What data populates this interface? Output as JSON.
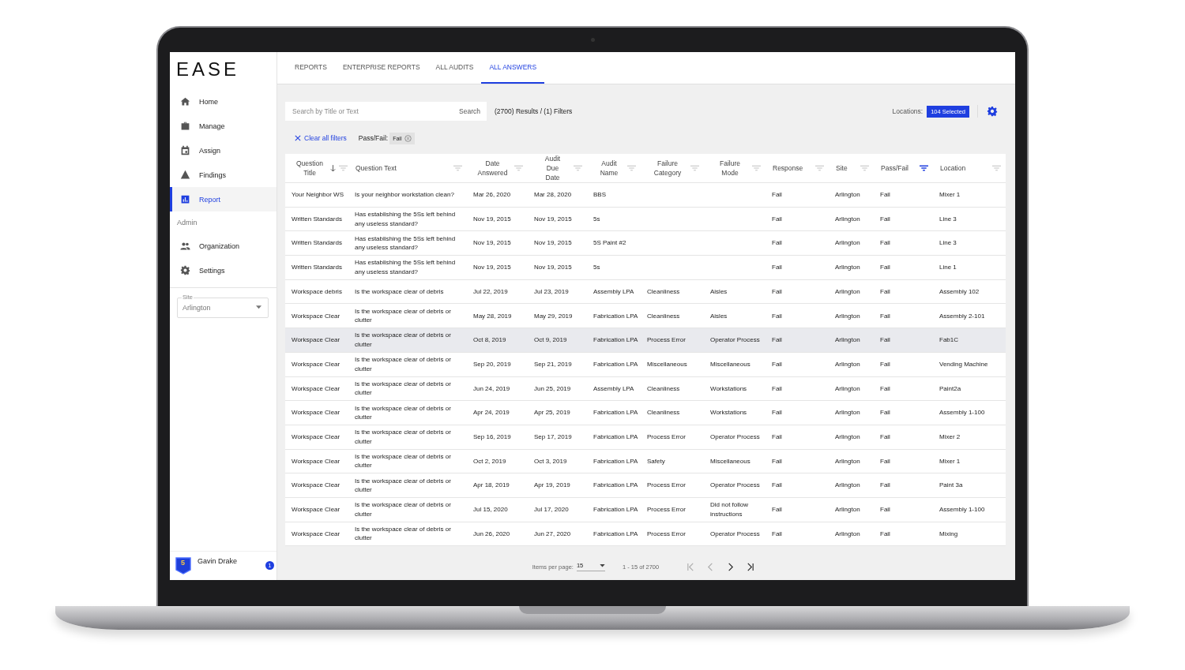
{
  "logo": "EASE",
  "sidebar": {
    "items": [
      {
        "label": "Home",
        "selected": false
      },
      {
        "label": "Manage",
        "selected": false
      },
      {
        "label": "Assign",
        "selected": false
      },
      {
        "label": "Findings",
        "selected": false
      },
      {
        "label": "Report",
        "selected": true
      }
    ],
    "section_label": "Admin",
    "admin_items": [
      {
        "label": "Organization",
        "selected": false
      },
      {
        "label": "Settings",
        "selected": false
      }
    ],
    "site_select": {
      "label": "Site",
      "value": "Arlington"
    },
    "user": {
      "name": "Gavin Drake",
      "level": "5",
      "notifications": "1"
    }
  },
  "tabs": [
    {
      "label": "REPORTS",
      "selected": false
    },
    {
      "label": "ENTERPRISE REPORTS",
      "selected": false
    },
    {
      "label": "ALL AUDITS",
      "selected": false
    },
    {
      "label": "ALL ANSWERS",
      "selected": true
    }
  ],
  "search": {
    "placeholder": "Search by Title or Text",
    "button": "Search"
  },
  "results_summary": "(2700) Results / (1) Filters",
  "locations": {
    "label": "Locations:",
    "value": "104 Selected"
  },
  "filters": {
    "clear_label": "Clear all filters",
    "chips": [
      {
        "label": "Pass/Fail:",
        "value": "Fail"
      }
    ]
  },
  "table": {
    "columns": [
      {
        "label": "Question Title",
        "sorted_desc": true,
        "filter_active": false
      },
      {
        "label": "Question Text",
        "sorted_desc": false,
        "filter_active": false
      },
      {
        "label": "Date Answered",
        "sorted_desc": false,
        "filter_active": false
      },
      {
        "label": "Audit Due Date",
        "sorted_desc": false,
        "filter_active": false
      },
      {
        "label": "Audit Name",
        "sorted_desc": false,
        "filter_active": false
      },
      {
        "label": "Failure Category",
        "sorted_desc": false,
        "filter_active": false
      },
      {
        "label": "Failure Mode",
        "sorted_desc": false,
        "filter_active": false
      },
      {
        "label": "Response",
        "sorted_desc": false,
        "filter_active": false
      },
      {
        "label": "Site",
        "sorted_desc": false,
        "filter_active": false
      },
      {
        "label": "Pass/Fail",
        "sorted_desc": false,
        "filter_active": true
      },
      {
        "label": "Location",
        "sorted_desc": false,
        "filter_active": false
      }
    ],
    "rows": [
      {
        "selected": false,
        "cells": [
          "Your Neighbor WS",
          "Is your neighbor workstation clean?",
          "Mar 26, 2020",
          "Mar 28, 2020",
          "BBS",
          null,
          null,
          "Fail",
          "Arlington",
          "Fail",
          "Mixer 1"
        ]
      },
      {
        "selected": false,
        "cells": [
          "Written Standards",
          "Has establishing the 5Ss left behind any useless standard?",
          "Nov 19, 2015",
          "Nov 19, 2015",
          "5s",
          null,
          null,
          "Fail",
          "Arlington",
          "Fail",
          "Line 3"
        ]
      },
      {
        "selected": false,
        "cells": [
          "Written Standards",
          "Has establishing the 5Ss left behind any useless standard?",
          "Nov 19, 2015",
          "Nov 19, 2015",
          "5S Paint #2",
          null,
          null,
          "Fail",
          "Arlington",
          "Fail",
          "Line 3"
        ]
      },
      {
        "selected": false,
        "cells": [
          "Written Standards",
          "Has establishing the 5Ss left behind any useless standard?",
          "Nov 19, 2015",
          "Nov 19, 2015",
          "5s",
          null,
          null,
          "Fail",
          "Arlington",
          "Fail",
          "Line 1"
        ]
      },
      {
        "selected": false,
        "cells": [
          "Workspace debris",
          "Is the workspace clear of debris",
          "Jul 22, 2019",
          "Jul 23, 2019",
          "Assembly LPA",
          "Cleanliness",
          "Aisles",
          "Fail",
          "Arlington",
          "Fail",
          "Assembly 102"
        ]
      },
      {
        "selected": false,
        "cells": [
          "Workspace Clear",
          "Is the workspace clear of debris or clutter",
          "May 28, 2019",
          "May 29, 2019",
          "Fabrication LPA",
          "Cleanliness",
          "Aisles",
          "Fail",
          "Arlington",
          "Fail",
          "Assembly 2-101"
        ]
      },
      {
        "selected": true,
        "cells": [
          "Workspace Clear",
          "Is the workspace clear of debris or clutter",
          "Oct 8, 2019",
          "Oct 9, 2019",
          "Fabrication LPA",
          "Process Error",
          "Operator Process",
          "Fail",
          "Arlington",
          "Fail",
          "Fab1C"
        ]
      },
      {
        "selected": false,
        "cells": [
          "Workspace Clear",
          "Is the workspace clear of debris or clutter",
          "Sep 20, 2019",
          "Sep 21, 2019",
          "Fabrication LPA",
          "Miscellaneous",
          "Miscellaneous",
          "Fail",
          "Arlington",
          "Fail",
          "Vending Machine"
        ]
      },
      {
        "selected": false,
        "cells": [
          "Workspace Clear",
          "Is the workspace clear of debris or clutter",
          "Jun 24, 2019",
          "Jun 25, 2019",
          "Assembly LPA",
          "Cleanliness",
          "Workstations",
          "Fail",
          "Arlington",
          "Fail",
          "Paint2a"
        ]
      },
      {
        "selected": false,
        "cells": [
          "Workspace Clear",
          "Is the workspace clear of debris or clutter",
          "Apr 24, 2019",
          "Apr 25, 2019",
          "Fabrication LPA",
          "Cleanliness",
          "Workstations",
          "Fail",
          "Arlington",
          "Fail",
          "Assembly 1-100"
        ]
      },
      {
        "selected": false,
        "cells": [
          "Workspace Clear",
          "Is the workspace clear of debris or clutter",
          "Sep 16, 2019",
          "Sep 17, 2019",
          "Fabrication LPA",
          "Process Error",
          "Operator Process",
          "Fail",
          "Arlington",
          "Fail",
          "Mixer 2"
        ]
      },
      {
        "selected": false,
        "cells": [
          "Workspace Clear",
          "Is the workspace clear of debris or clutter",
          "Oct 2, 2019",
          "Oct 3, 2019",
          "Fabrication LPA",
          "Safety",
          "Miscellaneous",
          "Fail",
          "Arlington",
          "Fail",
          "Mixer 1"
        ]
      },
      {
        "selected": false,
        "cells": [
          "Workspace Clear",
          "Is the workspace clear of debris or clutter",
          "Apr 18, 2019",
          "Apr 19, 2019",
          "Fabrication LPA",
          "Process Error",
          "Operator Process",
          "Fail",
          "Arlington",
          "Fail",
          "Paint 3a"
        ]
      },
      {
        "selected": false,
        "cells": [
          "Workspace Clear",
          "Is the workspace clear of debris or clutter",
          "Jul 15, 2020",
          "Jul 17, 2020",
          "Fabrication LPA",
          "Process Error",
          "Did not follow instructions",
          "Fail",
          "Arlington",
          "Fail",
          "Assembly 1-100"
        ]
      },
      {
        "selected": false,
        "cells": [
          "Workspace Clear",
          "Is the workspace clear of debris or clutter",
          "Jun 26, 2020",
          "Jun 27, 2020",
          "Fabrication LPA",
          "Process Error",
          "Operator Process",
          "Fail",
          "Arlington",
          "Fail",
          "Mixing"
        ]
      }
    ]
  },
  "pagination": {
    "items_per_page_label": "Items per page:",
    "items_per_page": "15",
    "range": "1 - 15 of 2700",
    "back_enabled": false,
    "forward_enabled": true
  }
}
